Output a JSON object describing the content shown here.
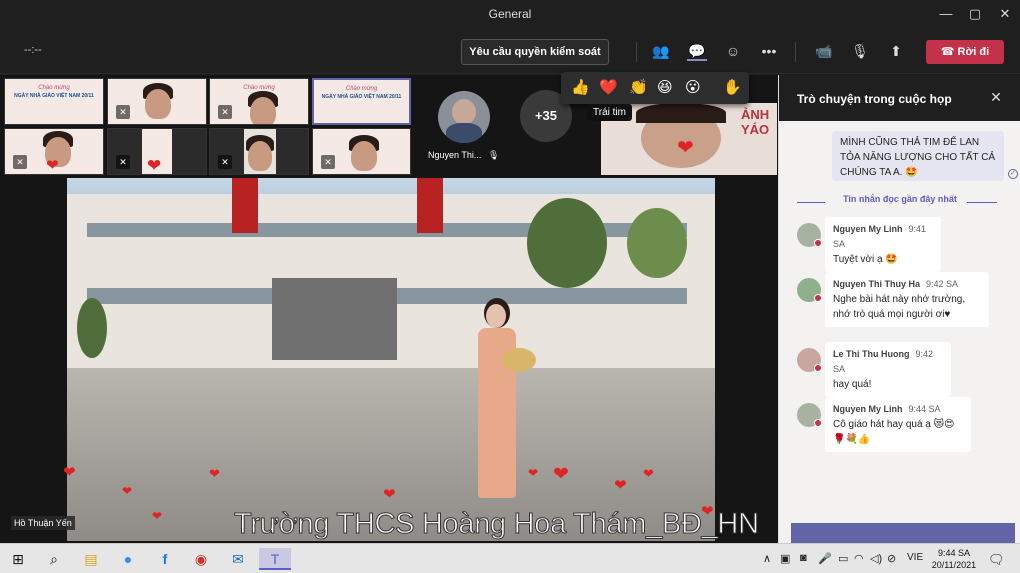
{
  "window": {
    "title": "General"
  },
  "toolbar": {
    "timer": "--:--",
    "request_control": "Yêu cầu quyền kiểm soát",
    "leave": "Rời đi"
  },
  "thumbnails": {
    "banner_line1": "Chào mừng",
    "banner_line2": "NGÀY NHÀ GIÁO VIỆT NAM 20/11",
    "participant_name": "Nguyen Thi...",
    "overflow_count": "+35"
  },
  "reactions": {
    "items": [
      "👍",
      "❤️",
      "👏",
      "😆",
      "😮",
      "✋"
    ],
    "tooltip": "Trái tim"
  },
  "main_video": {
    "subtitle": "Trường THCS Hoàng Hoa Thám_BĐ_HN",
    "local_name": "Hồ Thuận Yến"
  },
  "chat": {
    "title": "Trò chuyện trong cuộc họp",
    "my_message": "MÌNH CŨNG THẢ TIM ĐỂ LAN TỎA NĂNG LƯỢNG CHO TẤT CẢ CHÚNG TA A. 🤩",
    "recent_divider": "Tin nhắn đọc gần đây nhất",
    "messages": [
      {
        "sender": "Nguyen My Linh",
        "time": "9:41 SA",
        "text": "Tuyệt vời ạ 🤩"
      },
      {
        "sender": "Nguyen Thi Thuy Ha",
        "time": "9:42 SA",
        "text": "Nghe bài hát này nhớ trường, nhớ trò quá mọi người ơi♥"
      },
      {
        "sender": "Le Thi Thu Huong",
        "time": "9:42 SA",
        "text": "hay quá!"
      },
      {
        "sender": "Nguyen My Linh",
        "time": "9:44 SA",
        "text": "Cô giáo hát hay quá ạ 😻😍🌹💐👍"
      }
    ]
  },
  "taskbar": {
    "lang": "VIE",
    "time": "9:44 SA",
    "date": "20/11/2021"
  },
  "colors": {
    "accent": "#6264a7",
    "leave": "#c4314b",
    "heart": "#e02424"
  }
}
